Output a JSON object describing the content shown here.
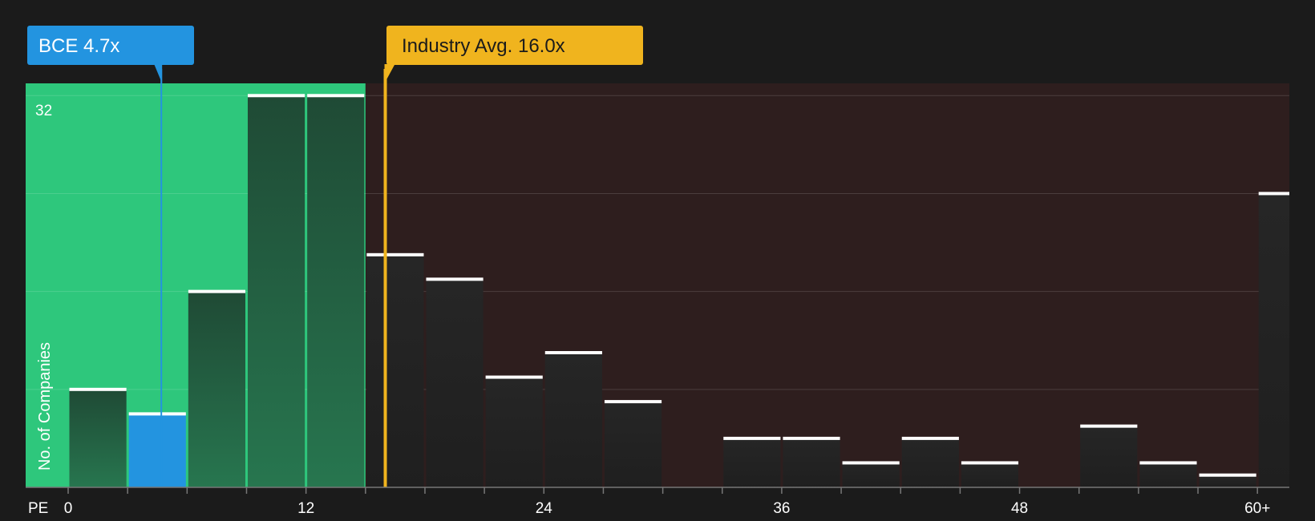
{
  "chart_data": {
    "type": "bar",
    "ylabel": "No. of Companies",
    "xlabel": "PE",
    "x_ticks": [
      "0",
      "12",
      "24",
      "36",
      "48",
      "60+"
    ],
    "y_tick_label": "32",
    "ylim": [
      0,
      33
    ],
    "bins": [
      {
        "start": 0,
        "end": 3,
        "count": 8
      },
      {
        "start": 3,
        "end": 6,
        "count": 6
      },
      {
        "start": 6,
        "end": 9,
        "count": 16
      },
      {
        "start": 9,
        "end": 12,
        "count": 32
      },
      {
        "start": 12,
        "end": 15,
        "count": 32
      },
      {
        "start": 15,
        "end": 18,
        "count": 19
      },
      {
        "start": 18,
        "end": 21,
        "count": 17
      },
      {
        "start": 21,
        "end": 24,
        "count": 9
      },
      {
        "start": 24,
        "end": 27,
        "count": 11
      },
      {
        "start": 27,
        "end": 30,
        "count": 7
      },
      {
        "start": 30,
        "end": 33,
        "count": 0
      },
      {
        "start": 33,
        "end": 36,
        "count": 4
      },
      {
        "start": 36,
        "end": 39,
        "count": 4
      },
      {
        "start": 39,
        "end": 42,
        "count": 2
      },
      {
        "start": 42,
        "end": 45,
        "count": 4
      },
      {
        "start": 45,
        "end": 48,
        "count": 2
      },
      {
        "start": 48,
        "end": 51,
        "count": 0
      },
      {
        "start": 51,
        "end": 54,
        "count": 5
      },
      {
        "start": 54,
        "end": 57,
        "count": 2
      },
      {
        "start": 57,
        "end": 60,
        "count": 1
      },
      {
        "start": 60,
        "end": 63,
        "count": 24
      }
    ],
    "company": {
      "label": "BCE 4.7x",
      "pe": 4.7,
      "color": "#2394e0"
    },
    "industry": {
      "label": "Industry Avg. 16.0x",
      "pe": 16.0,
      "color": "#f0b41e"
    },
    "colors": {
      "background": "#1b1b1b",
      "undervalued_zone": "#2ec77c",
      "overvalued_zone": "#2e1e1e",
      "bar_in_zone": "#235a3e",
      "bar_default": "#232323",
      "bar_highlight": "#2394e0",
      "bar_top": "#ffffff"
    }
  }
}
